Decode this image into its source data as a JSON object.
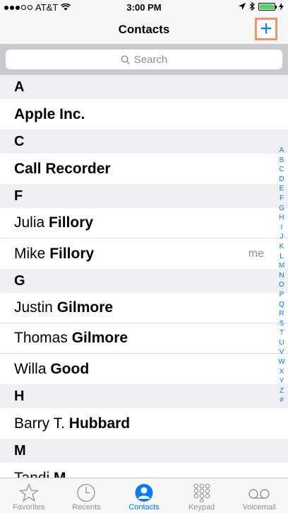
{
  "status": {
    "carrier": "AT&T",
    "time": "3:00 PM"
  },
  "nav": {
    "title": "Contacts",
    "add_label": "+"
  },
  "search": {
    "placeholder": "Search"
  },
  "sections": [
    {
      "letter": "A",
      "rows": [
        {
          "first": "Apple Inc.",
          "last": "",
          "bold_all": true
        }
      ]
    },
    {
      "letter": "C",
      "rows": [
        {
          "first": "Call Recorder",
          "last": "",
          "bold_all": true
        }
      ]
    },
    {
      "letter": "F",
      "rows": [
        {
          "first": "Julia ",
          "last": "Fillory"
        },
        {
          "first": "Mike ",
          "last": "Fillory",
          "badge": "me"
        }
      ]
    },
    {
      "letter": "G",
      "rows": [
        {
          "first": "Justin ",
          "last": "Gilmore"
        },
        {
          "first": "Thomas ",
          "last": "Gilmore"
        },
        {
          "first": "Willa ",
          "last": "Good"
        }
      ]
    },
    {
      "letter": "H",
      "rows": [
        {
          "first": "Barry T. ",
          "last": "Hubbard"
        }
      ]
    },
    {
      "letter": "M",
      "rows": [
        {
          "first": "Tandi ",
          "last": "M"
        }
      ]
    }
  ],
  "index": [
    "A",
    "B",
    "C",
    "D",
    "E",
    "F",
    "G",
    "H",
    "I",
    "J",
    "K",
    "L",
    "M",
    "N",
    "O",
    "P",
    "Q",
    "R",
    "S",
    "T",
    "U",
    "V",
    "W",
    "X",
    "Y",
    "Z",
    "#"
  ],
  "tabs": [
    {
      "label": "Favorites",
      "icon": "star-icon",
      "active": false
    },
    {
      "label": "Recents",
      "icon": "clock-icon",
      "active": false
    },
    {
      "label": "Contacts",
      "icon": "person-icon",
      "active": true
    },
    {
      "label": "Keypad",
      "icon": "keypad-icon",
      "active": false
    },
    {
      "label": "Voicemail",
      "icon": "voicemail-icon",
      "active": false
    }
  ],
  "colors": {
    "accent": "#007aff",
    "highlight_border": "#f1946a",
    "battery": "#4cd964"
  }
}
